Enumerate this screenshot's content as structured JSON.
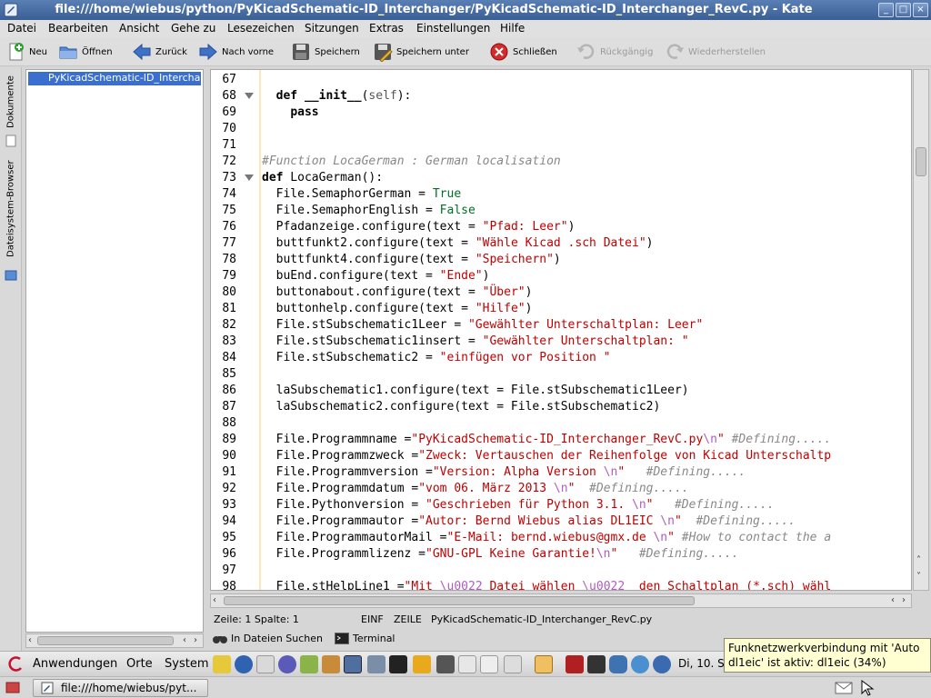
{
  "window": {
    "title": "file:///home/wiebus/python/PyKicadSchematic-ID_Interchanger/PyKicadSchematic-ID_Interchanger_RevC.py - Kate"
  },
  "menu": [
    "Datei",
    "Bearbeiten",
    "Ansicht",
    "Gehe zu",
    "Lesezeichen",
    "Sitzungen",
    "Extras",
    "Einstellungen",
    "Hilfe"
  ],
  "toolbar": {
    "new": "Neu",
    "open": "Öffnen",
    "back": "Zurück",
    "forward": "Nach vorne",
    "save": "Speichern",
    "save_as": "Speichern unter",
    "close": "Schließen",
    "undo": "Rückgängig",
    "redo": "Wiederherstellen"
  },
  "sidebar": {
    "tab_documents": "Dokumente",
    "tab_filesystem": "Dateisystem-Browser",
    "documents": [
      "PyKicadSchematic-ID_Interchanger_RevC.py"
    ]
  },
  "editor": {
    "lines": [
      {
        "n": "67",
        "fold": false,
        "html": ""
      },
      {
        "n": "68",
        "fold": true,
        "html": "  <span class=\"kw\">def</span> <span class=\"kw\">__init__</span>(<span class=\"self\">self</span>):"
      },
      {
        "n": "69",
        "fold": false,
        "html": "    <span class=\"kw\">pass</span>"
      },
      {
        "n": "70",
        "fold": false,
        "html": ""
      },
      {
        "n": "71",
        "fold": false,
        "html": ""
      },
      {
        "n": "72",
        "fold": false,
        "html": "<span class=\"cm\">#Function LocaGerman : German localisation</span>"
      },
      {
        "n": "73",
        "fold": true,
        "html": "<span class=\"kw\">def</span> LocaGerman():"
      },
      {
        "n": "74",
        "fold": false,
        "html": "  File.SemaphorGerman = <span class=\"bool\">True</span>"
      },
      {
        "n": "75",
        "fold": false,
        "html": "  File.SemaphorEnglish = <span class=\"bool\">False</span>"
      },
      {
        "n": "76",
        "fold": false,
        "html": "  Pfadanzeige.configure(text = <span class=\"str\">\"Pfad: Leer\"</span>)"
      },
      {
        "n": "77",
        "fold": false,
        "html": "  buttfunkt2.configure(text = <span class=\"str\">\"Wähle Kicad .sch Datei\"</span>)"
      },
      {
        "n": "78",
        "fold": false,
        "html": "  buttfunkt4.configure(text = <span class=\"str\">\"Speichern\"</span>)"
      },
      {
        "n": "79",
        "fold": false,
        "html": "  buEnd.configure(text = <span class=\"str\">\"Ende\"</span>)"
      },
      {
        "n": "80",
        "fold": false,
        "html": "  buttonabout.configure(text = <span class=\"str\">\"Über\"</span>)"
      },
      {
        "n": "81",
        "fold": false,
        "html": "  buttonhelp.configure(text = <span class=\"str\">\"Hilfe\"</span>)"
      },
      {
        "n": "82",
        "fold": false,
        "html": "  File.stSubschematic1Leer = <span class=\"str\">\"Gewählter Unterschaltplan: Leer\"</span>"
      },
      {
        "n": "83",
        "fold": false,
        "html": "  File.stSubschematic1insert = <span class=\"str\">\"Gewählter Unterschaltplan: \"</span>"
      },
      {
        "n": "84",
        "fold": false,
        "html": "  File.stSubschematic2 = <span class=\"str\">\"einfügen vor Position \"</span>"
      },
      {
        "n": "85",
        "fold": false,
        "html": ""
      },
      {
        "n": "86",
        "fold": false,
        "html": "  laSubschematic1.configure(text = File.stSubschematic1Leer)"
      },
      {
        "n": "87",
        "fold": false,
        "html": "  laSubschematic2.configure(text = File.stSubschematic2)"
      },
      {
        "n": "88",
        "fold": false,
        "html": ""
      },
      {
        "n": "89",
        "fold": false,
        "html": "  File.Programmname =<span class=\"str\">\"PyKicadSchematic-ID_Interchanger_RevC.py</span><span class=\"esc\">\\n</span><span class=\"str\">\"</span> <span class=\"cm\">#Defining.....</span>"
      },
      {
        "n": "90",
        "fold": false,
        "html": "  File.Programmzweck =<span class=\"str\">\"Zweck: Vertauschen der Reihenfolge von Kicad Unterschaltp</span>"
      },
      {
        "n": "91",
        "fold": false,
        "html": "  File.Programmversion =<span class=\"str\">\"Version: Alpha Version </span><span class=\"esc\">\\n</span><span class=\"str\">\"</span>   <span class=\"cm\">#Defining.....</span>"
      },
      {
        "n": "92",
        "fold": false,
        "html": "  File.Programmdatum =<span class=\"str\">\"vom 06. März 2013 </span><span class=\"esc\">\\n</span><span class=\"str\">\"</span>  <span class=\"cm\">#Defining.....</span>"
      },
      {
        "n": "93",
        "fold": false,
        "html": "  File.Pythonversion = <span class=\"str\">\"Geschrieben für Python 3.1. </span><span class=\"esc\">\\n</span><span class=\"str\">\"</span>   <span class=\"cm\">#Defining.....</span>"
      },
      {
        "n": "94",
        "fold": false,
        "html": "  File.Programmautor =<span class=\"str\">\"Autor: Bernd Wiebus alias DL1EIC </span><span class=\"esc\">\\n</span><span class=\"str\">\"</span>  <span class=\"cm\">#Defining.....</span>"
      },
      {
        "n": "95",
        "fold": false,
        "html": "  File.ProgrammautorMail =<span class=\"str\">\"E-Mail: bernd.wiebus@gmx.de </span><span class=\"esc\">\\n</span><span class=\"str\">\"</span> <span class=\"cm\">#How to contact the a</span>"
      },
      {
        "n": "96",
        "fold": false,
        "html": "  File.Programmlizenz =<span class=\"str\">\"GNU-GPL Keine Garantie!</span><span class=\"esc\">\\n</span><span class=\"str\">\"</span>   <span class=\"cm\">#Defining.....</span>"
      },
      {
        "n": "97",
        "fold": false,
        "html": ""
      },
      {
        "n": "98",
        "fold": false,
        "html": "  File.stHelpLine1 =<span class=\"str\">\"Mit </span><span class=\"esc\">\\u0022</span><span class=\"str\"> Datei wählen </span><span class=\"esc\">\\u0022</span><span class=\"str\">  den Schaltplan (*.sch) wähl</span>"
      }
    ]
  },
  "status": {
    "cursor": "Zeile: 1 Spalte: 1",
    "mode": "EINF",
    "selection": "ZEILE",
    "filename": "PyKicadSchematic-ID_Interchanger_RevC.py"
  },
  "toolviews": {
    "find_in_files": "In Dateien Suchen",
    "terminal": "Terminal"
  },
  "panel": {
    "applications": "Anwendungen",
    "places": "Orte",
    "system": "System",
    "clock": "Di, 10. S"
  },
  "taskbar": {
    "window": "file:///home/wiebus/pyt..."
  },
  "tooltip": {
    "text": "Funknetzwerkverbindung mit 'Auto dl1eic' ist aktiv: dl1eic (34%)"
  }
}
